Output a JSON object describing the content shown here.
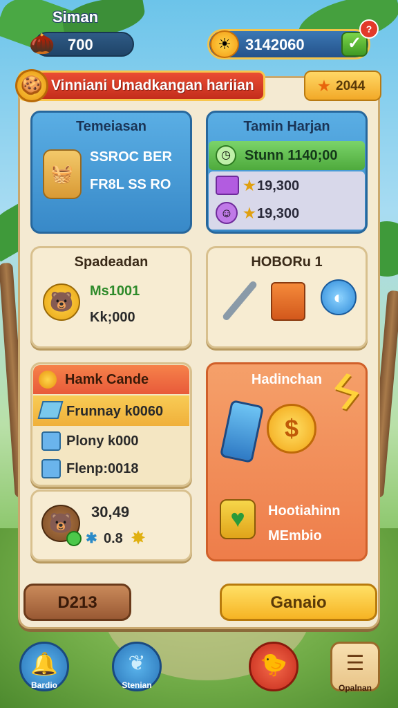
{
  "header": {
    "player_name": "Siman",
    "seed_amount": "700",
    "coin_amount": "3142060",
    "add_label": "✓",
    "notification_count": "?"
  },
  "banner": {
    "title": "Vinniani Umadkangan hariian",
    "star_value": "2044"
  },
  "cards": {
    "storage": {
      "title": "Temeiasan",
      "line1": "SSROC BER",
      "line2": "FR8L SS RO"
    },
    "daily": {
      "title": "Tamin Harjan",
      "row1": "Stunn 1140;00",
      "row2": "19,300",
      "row3": "19,300"
    },
    "pet": {
      "title": "Spadeadan",
      "line1": "Ms1001",
      "line2": "Kk;000"
    },
    "tools": {
      "title": "HOBORu 1"
    },
    "market": {
      "title": "Hamk Cande",
      "row1": "Frunnay k0060",
      "row2": "Plony k000",
      "row3": "Flenp:0018"
    },
    "bonus": {
      "value": "30,49",
      "sub": "0.8"
    },
    "offer": {
      "title": "Hadinchan",
      "line1": "Hootiahinn",
      "line2": "MEmbio"
    }
  },
  "buttons": {
    "left": "D213",
    "right": "Ganaio"
  },
  "nav": {
    "item1": "Bardio",
    "item2": "Stenian",
    "item4": "Opalnan"
  }
}
